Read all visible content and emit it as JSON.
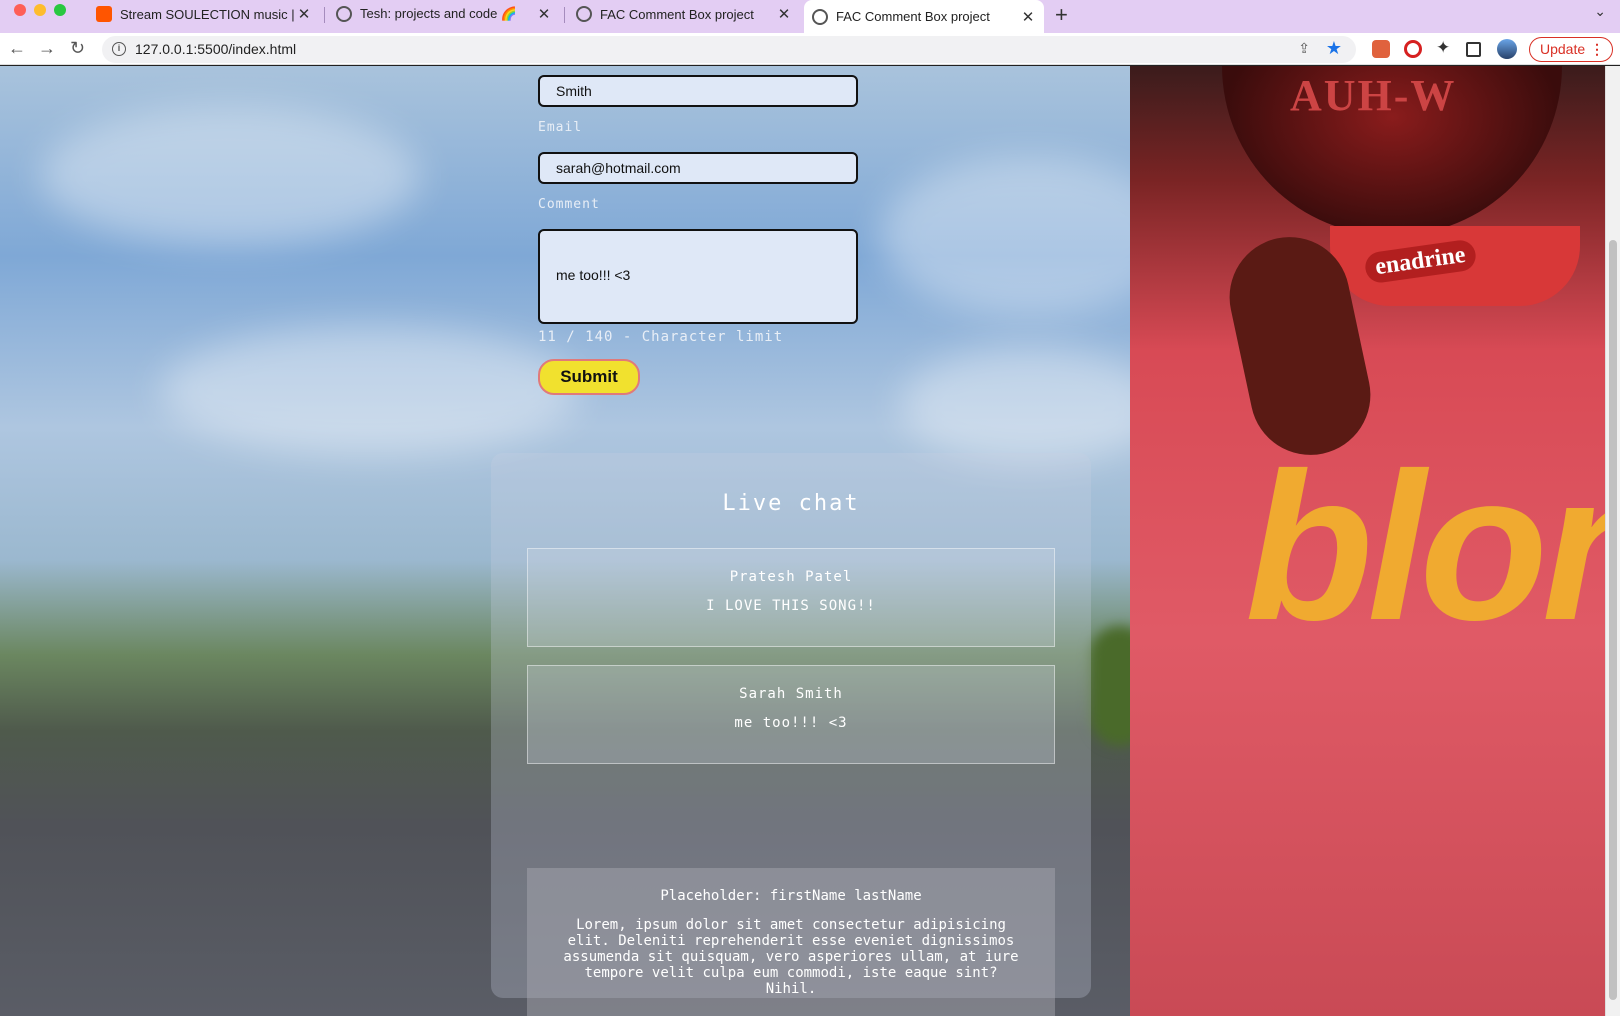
{
  "browser": {
    "tabs": [
      {
        "title": "Stream SOULECTION music | L",
        "icon": "soundcloud-icon"
      },
      {
        "title": "Tesh: projects and code 🌈",
        "icon": "globe-icon"
      },
      {
        "title": "FAC Comment Box project",
        "icon": "globe-icon"
      },
      {
        "title": "FAC Comment Box project",
        "icon": "globe-icon",
        "active": true
      }
    ],
    "url": "127.0.0.1:5500/index.html",
    "update_label": "Update"
  },
  "form": {
    "last_name_value": "Smith",
    "email_label": "Email",
    "email_value": "sarah@hotmail.com",
    "comment_label": "Comment",
    "comment_value": "me too!!! <3",
    "counter": "11 / 140 - Character limit",
    "submit_label": "Submit"
  },
  "chat": {
    "title": "Live chat",
    "messages": [
      {
        "name": "Pratesh Patel",
        "text": "I LOVE THIS SONG!!"
      },
      {
        "name": "Sarah Smith",
        "text": "me too!!! <3"
      }
    ],
    "placeholder": {
      "name": "Placeholder: firstName lastName",
      "body": "Lorem, ipsum dolor sit amet consectetur adipisicing elit. Deleniti reprehenderit esse eveniet dignissimos assumenda sit quisquam, vero asperiores ullam, at iure tempore velit culpa eum commodi, iste eaque sint? Nihil."
    }
  },
  "artwork": {
    "helmet_text": "AUH-W",
    "visor_text": "enadrine",
    "album_text": "blon"
  },
  "colors": {
    "tab_bar": "#e3cdf3",
    "submit": "#f1e12e",
    "accent_blue": "#1a73e8"
  }
}
